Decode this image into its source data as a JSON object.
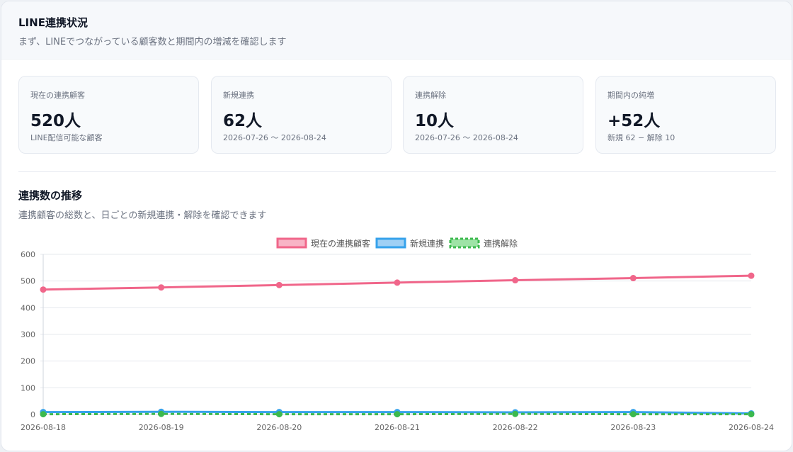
{
  "header": {
    "title": "LINE連携状況",
    "subtitle": "まず、LINEでつながっている顧客数と期間内の増減を確認します"
  },
  "stats": [
    {
      "label": "現在の連携顧客",
      "value": "520人",
      "sub": "LINE配信可能な顧客"
    },
    {
      "label": "新規連携",
      "value": "62人",
      "sub": "2026-07-26 〜 2026-08-24"
    },
    {
      "label": "連携解除",
      "value": "10人",
      "sub": "2026-07-26 〜 2026-08-24"
    },
    {
      "label": "期間内の純増",
      "value": "+52人",
      "sub": "新規 62 − 解除 10"
    }
  ],
  "section": {
    "title": "連携数の推移",
    "subtitle": "連携顧客の総数と、日ごとの新規連携・解除を確認できます"
  },
  "chart_data": {
    "type": "line",
    "title": "",
    "xlabel": "",
    "ylabel": "",
    "x": [
      "2026-08-18",
      "2026-08-19",
      "2026-08-20",
      "2026-08-21",
      "2026-08-22",
      "2026-08-23",
      "2026-08-24"
    ],
    "ylim": [
      0,
      600
    ],
    "yticks": [
      0,
      100,
      200,
      300,
      400,
      500,
      600
    ],
    "grid": true,
    "legend": "top-center",
    "series": [
      {
        "name": "現在の連携顧客",
        "values": [
          468,
          476,
          485,
          494,
          503,
          511,
          520
        ],
        "color": "#f0668a",
        "fill": "#f8b4c6",
        "dashed": false
      },
      {
        "name": "新規連携",
        "values": [
          9,
          10,
          9,
          9,
          8,
          9,
          4
        ],
        "color": "#36a2eb",
        "fill": "#9fd0f5",
        "dashed": false
      },
      {
        "name": "連携解除",
        "values": [
          1,
          2,
          1,
          1,
          2,
          1,
          1
        ],
        "color": "#3cb94e",
        "fill": "#9ee3a6",
        "dashed": true
      }
    ]
  }
}
